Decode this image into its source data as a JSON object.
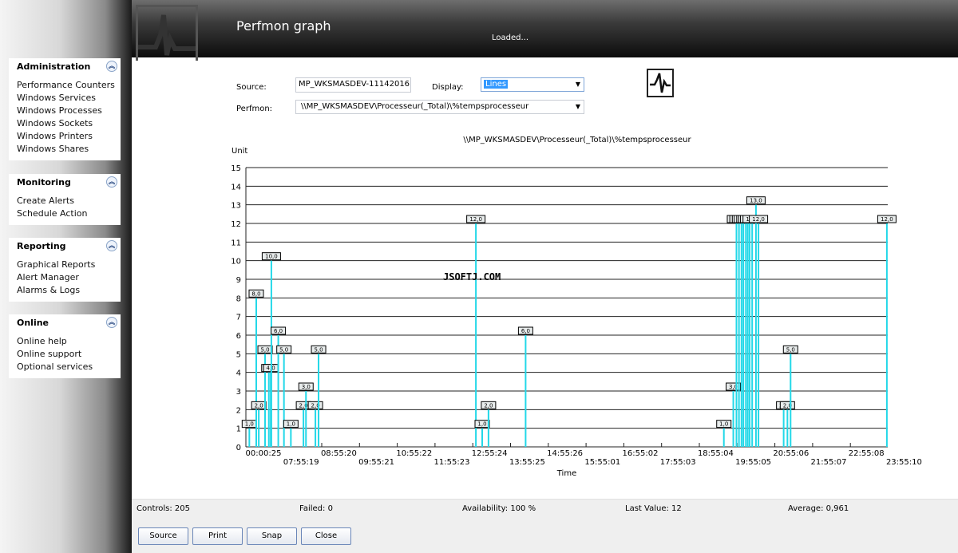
{
  "sidebar": {
    "sections": [
      {
        "title": "Administration",
        "items": [
          "Performance Counters",
          "Windows Services",
          "Windows Processes",
          "Windows Sockets",
          "Windows Printers",
          "Windows Shares"
        ]
      },
      {
        "title": "Monitoring",
        "items": [
          "Create Alerts",
          "Schedule Action"
        ]
      },
      {
        "title": "Reporting",
        "items": [
          "Graphical Reports",
          "Alert Manager",
          "Alarms & Logs"
        ]
      },
      {
        "title": "Online",
        "items": [
          "Online help",
          "Online support",
          "Optional services"
        ]
      }
    ],
    "collapse_icon": "double-chevron-up-icon"
  },
  "header": {
    "title": "Perfmon graph",
    "status": "Loaded..."
  },
  "form": {
    "source_label": "Source:",
    "source_value": "MP_WKSMASDEV-11142016P",
    "display_label": "Display:",
    "display_value": "Lines",
    "perfmon_label": "Perfmon:",
    "perfmon_value": "\\\\MP_WKSMASDEV\\Processeur(_Total)\\%tempsprocesseur"
  },
  "watermark": "JSOFTJ.COM",
  "chart_data": {
    "type": "bar",
    "title": "\\\\MP_WKSMASDEV\\Processeur(_Total)\\%tempsprocesseur",
    "xlabel": "Time",
    "ylabel": "Unit",
    "ylim": [
      0,
      15
    ],
    "grid": true,
    "series_color": "#22d8e8",
    "yticks": [
      0,
      1,
      2,
      3,
      4,
      5,
      6,
      7,
      8,
      9,
      10,
      11,
      12,
      13,
      14,
      15
    ],
    "xticks": [
      "00:00:25",
      "07:55:19",
      "08:55:20",
      "09:55:21",
      "10:55:22",
      "11:55:23",
      "12:55:24",
      "13:55:25",
      "14:55:26",
      "15:55:01",
      "16:55:02",
      "17:55:03",
      "18:55:04",
      "19:55:05",
      "20:55:06",
      "21:55:07",
      "22:55:08",
      "23:55:10"
    ],
    "points": [
      {
        "x": "06:32",
        "y": 1
      },
      {
        "x": "06:43",
        "y": 8
      },
      {
        "x": "06:47",
        "y": 2
      },
      {
        "x": "06:57",
        "y": 5
      },
      {
        "x": "07:03",
        "y": 4
      },
      {
        "x": "07:06",
        "y": 4
      },
      {
        "x": "07:07",
        "y": 10
      },
      {
        "x": "07:18",
        "y": 6
      },
      {
        "x": "07:27",
        "y": 5
      },
      {
        "x": "07:38",
        "y": 1
      },
      {
        "x": "07:58",
        "y": 2
      },
      {
        "x": "08:02",
        "y": 3
      },
      {
        "x": "08:17",
        "y": 2
      },
      {
        "x": "08:22",
        "y": 5
      },
      {
        "x": "12:32",
        "y": 12
      },
      {
        "x": "12:42",
        "y": 1
      },
      {
        "x": "12:52",
        "y": 2
      },
      {
        "x": "13:51",
        "y": 6
      },
      {
        "x": "19:06",
        "y": 1
      },
      {
        "x": "19:21",
        "y": 3
      },
      {
        "x": "19:26",
        "y": 12
      },
      {
        "x": "19:30",
        "y": 12
      },
      {
        "x": "19:34",
        "y": 12
      },
      {
        "x": "19:37",
        "y": 12
      },
      {
        "x": "19:41",
        "y": 12
      },
      {
        "x": "19:44",
        "y": 12
      },
      {
        "x": "19:47",
        "y": 12
      },
      {
        "x": "19:51",
        "y": 12
      },
      {
        "x": "19:57",
        "y": 13
      },
      {
        "x": "20:01",
        "y": 12
      },
      {
        "x": "20:41",
        "y": 2
      },
      {
        "x": "20:47",
        "y": 2
      },
      {
        "x": "20:52",
        "y": 5
      },
      {
        "x": "23:25",
        "y": 12
      }
    ]
  },
  "footer": {
    "controls": "Controls: 205",
    "failed": "Failed: 0",
    "availability": "Availability: 100 %",
    "last_value": "Last Value: 12",
    "average": "Average: 0,961",
    "buttons": [
      "Source",
      "Print",
      "Snap",
      "Close"
    ]
  }
}
